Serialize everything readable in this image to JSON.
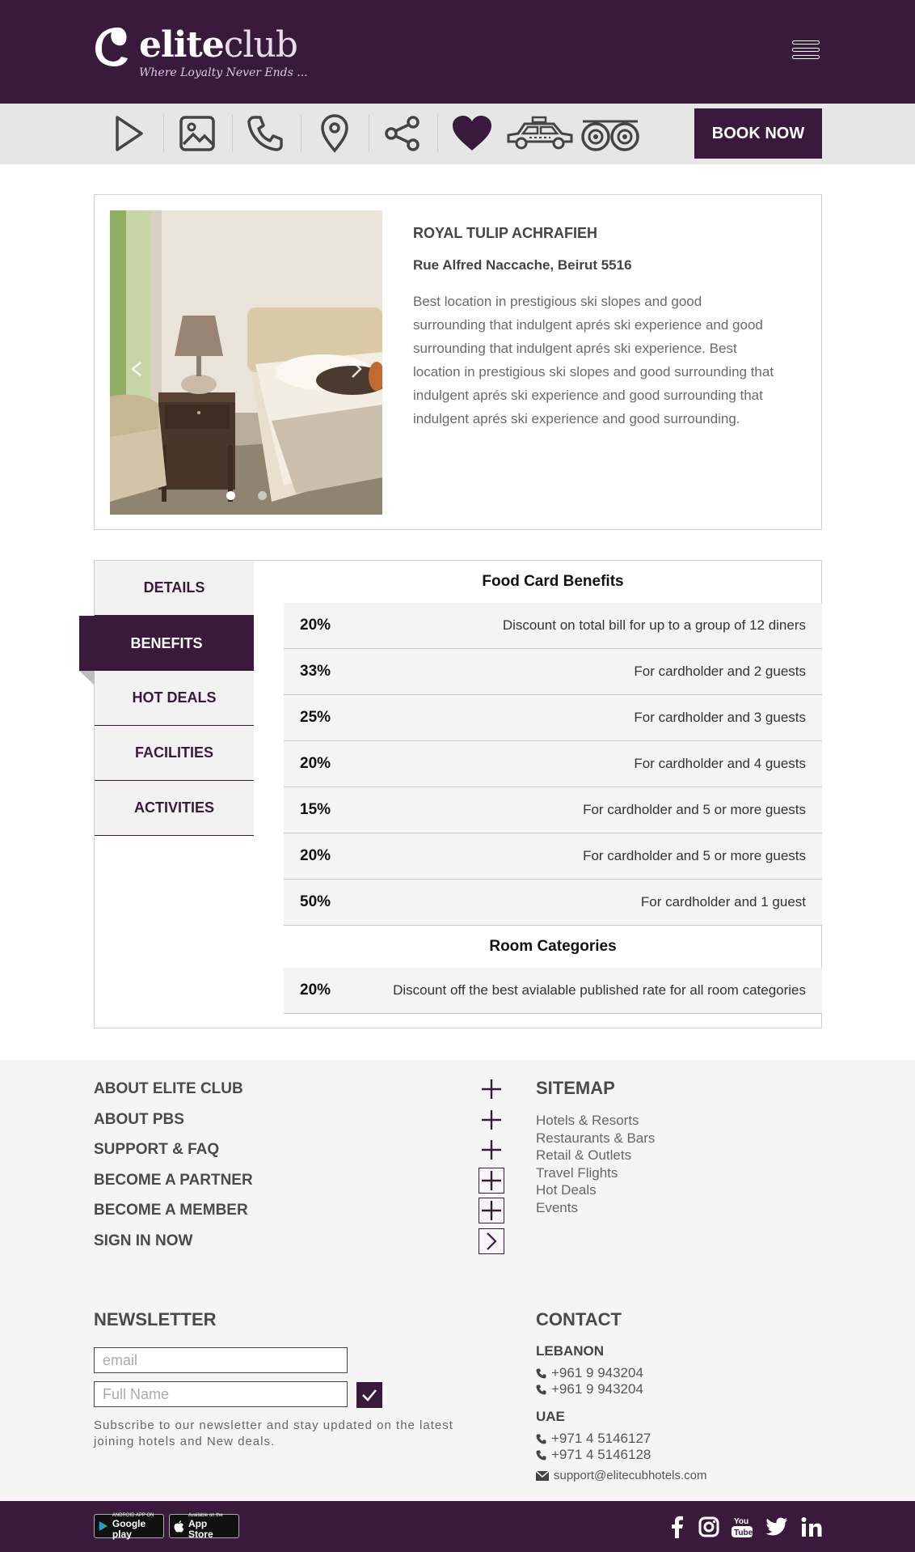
{
  "brand": {
    "name_part1": "elite",
    "name_part2": "club",
    "tagline": "Where Loyalty Never Ends ...",
    "primary_color": "#3a1a3c"
  },
  "header": {
    "menu_icon": "hamburger-icon"
  },
  "iconbar": {
    "icons": [
      "play-icon",
      "gallery-icon",
      "phone-icon",
      "location-pin-icon",
      "share-icon",
      "heart-icon",
      "taxi-icon",
      "tripadvisor-icon"
    ],
    "book_label": "BOOK NOW"
  },
  "hotel": {
    "name": "ROYAL TULIP ACHRAFIEH",
    "address": "Rue Alfred Naccache, Beirut 5516",
    "description": "Best location in prestigious ski slopes and good surrounding that indulgent aprés ski experience and good surrounding that indulgent aprés ski experience. Best location in prestigious ski slopes and good surrounding that indulgent aprés ski experience and good surrounding that indulgent aprés ski experience and good surrounding.",
    "slides": 2,
    "active_slide": 1
  },
  "tabs": {
    "items": [
      "DETAILS",
      "BENEFITS",
      "HOT DEALS",
      "FACILITIES",
      "ACTIVITIES"
    ],
    "active": "BENEFITS"
  },
  "benefits": {
    "food_title": "Food Card Benefits",
    "food_rows": [
      {
        "pct": "20%",
        "desc": "Discount on total bill for up to a group of 12 diners"
      },
      {
        "pct": "33%",
        "desc": "For cardholder and 2 guests"
      },
      {
        "pct": "25%",
        "desc": "For cardholder and 3 guests"
      },
      {
        "pct": "20%",
        "desc": "For cardholder and 4 guests"
      },
      {
        "pct": "15%",
        "desc": "For cardholder and 5 or more guests"
      },
      {
        "pct": "20%",
        "desc": "For cardholder and 5 or more guests"
      },
      {
        "pct": "50%",
        "desc": "For cardholder and 1 guest"
      }
    ],
    "room_title": "Room Categories",
    "room_rows": [
      {
        "pct": "20%",
        "desc": "Discount off the best avialable published rate for all room categories"
      }
    ]
  },
  "footer": {
    "links": [
      {
        "label": "ABOUT ELITE CLUB",
        "action": "plus"
      },
      {
        "label": "ABOUT PBS",
        "action": "plus"
      },
      {
        "label": "SUPPORT & FAQ",
        "action": "plus"
      },
      {
        "label": "BECOME A PARTNER",
        "action": "plus-box"
      },
      {
        "label": "BECOME A MEMBER",
        "action": "plus-box"
      },
      {
        "label": "SIGN IN NOW",
        "action": "arrow-box"
      }
    ],
    "sitemap_title": "SITEMAP",
    "sitemap": [
      "Hotels & Resorts",
      "Restaurants & Bars",
      "Retail & Outlets",
      "Travel Flights",
      "Hot Deals",
      "Events"
    ],
    "newsletter_title": "NEWSLETTER",
    "email_placeholder": "email",
    "name_placeholder": "Full Name",
    "newsletter_note": "Subscribe to our newsletter and stay updated on the latest joining hotels and New deals.",
    "contact_title": "CONTACT",
    "lebanon_label": "LEBANON",
    "lebanon_phones": [
      "+961 9 943204",
      "+961 9 943204"
    ],
    "uae_label": "UAE",
    "uae_phones": [
      "+971 4 5146127",
      "+971 4 5146128"
    ],
    "email": "support@elitecubhotels.com"
  },
  "bottombar": {
    "google_small": "ANDROID APP ON",
    "google_big": "Google play",
    "apple_small": "Available on the",
    "apple_big": "App Store",
    "social": [
      "facebook-icon",
      "instagram-icon",
      "youtube-icon",
      "twitter-icon",
      "linkedin-icon"
    ]
  }
}
